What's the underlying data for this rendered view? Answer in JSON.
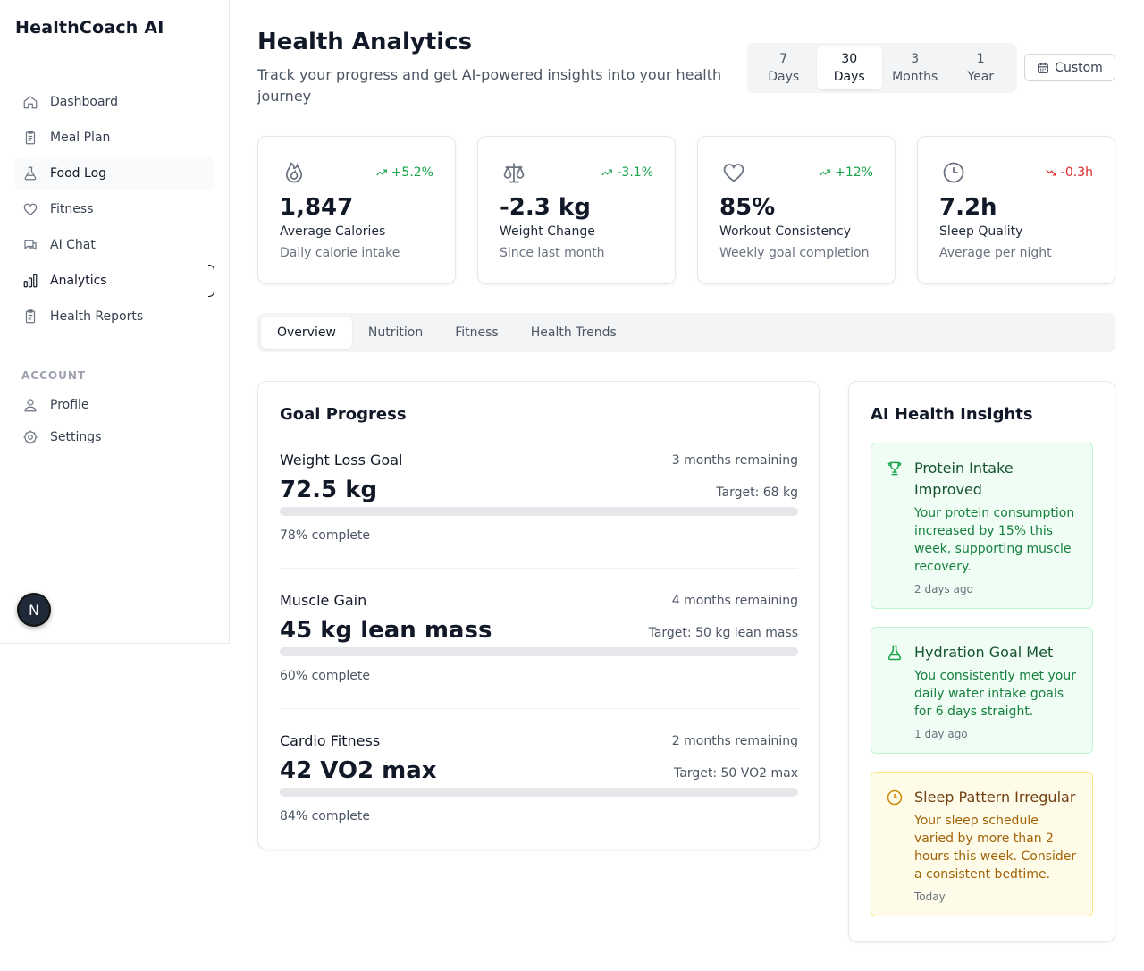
{
  "app": {
    "name": "HealthCoach AI"
  },
  "sidebar": {
    "items": [
      {
        "label": "Dashboard",
        "icon": "home-icon"
      },
      {
        "label": "Meal Plan",
        "icon": "clipboard-icon"
      },
      {
        "label": "Food Log",
        "icon": "flask-icon"
      },
      {
        "label": "Fitness",
        "icon": "heart-icon"
      },
      {
        "label": "AI Chat",
        "icon": "chat-icon"
      },
      {
        "label": "Analytics",
        "icon": "bar-chart-icon"
      },
      {
        "label": "Health Reports",
        "icon": "clipboard-icon"
      }
    ],
    "account_label": "ACCOUNT",
    "account_items": [
      {
        "label": "Profile",
        "icon": "user-icon"
      },
      {
        "label": "Settings",
        "icon": "gear-icon"
      }
    ],
    "badge": "N"
  },
  "header": {
    "title": "Health Analytics",
    "subtitle": "Track your progress and get AI-powered insights into your health journey",
    "ranges": [
      {
        "num": "7",
        "unit": "Days"
      },
      {
        "num": "30",
        "unit": "Days"
      },
      {
        "num": "3",
        "unit": "Months"
      },
      {
        "num": "1",
        "unit": "Year"
      }
    ],
    "selected_range": "30 Days",
    "custom_label": "Custom"
  },
  "stats": [
    {
      "value": "1,847",
      "label": "Average Calories",
      "sub": "Daily calorie intake",
      "trend": "+5.2%",
      "trend_dir": "up",
      "icon": "flame-icon"
    },
    {
      "value": "-2.3 kg",
      "label": "Weight Change",
      "sub": "Since last month",
      "trend": "-3.1%",
      "trend_dir": "up",
      "icon": "scale-icon"
    },
    {
      "value": "85%",
      "label": "Workout Consistency",
      "sub": "Weekly goal completion",
      "trend": "+12%",
      "trend_dir": "up",
      "icon": "heart-icon"
    },
    {
      "value": "7.2h",
      "label": "Sleep Quality",
      "sub": "Average per night",
      "trend": "-0.3h",
      "trend_dir": "down",
      "icon": "clock-icon"
    }
  ],
  "tabs": [
    "Overview",
    "Nutrition",
    "Fitness",
    "Health Trends"
  ],
  "goals": {
    "title": "Goal Progress",
    "items": [
      {
        "name": "Weight Loss Goal",
        "remaining": "3 months remaining",
        "value": "72.5 kg",
        "target": "Target: 68 kg",
        "percent": 78,
        "percent_label": "78% complete"
      },
      {
        "name": "Muscle Gain",
        "remaining": "4 months remaining",
        "value": "45 kg lean mass",
        "target": "Target: 50 kg lean mass",
        "percent": 60,
        "percent_label": "60% complete"
      },
      {
        "name": "Cardio Fitness",
        "remaining": "2 months remaining",
        "value": "42 VO2 max",
        "target": "Target: 50 VO2 max",
        "percent": 84,
        "percent_label": "84% complete"
      }
    ]
  },
  "insights": {
    "title": "AI Health Insights",
    "items": [
      {
        "title": "Protein Intake Improved",
        "text": "Your protein consumption increased by 15% this week, supporting muscle recovery.",
        "time": "2 days ago",
        "tone": "green",
        "icon": "trophy-icon"
      },
      {
        "title": "Hydration Goal Met",
        "text": "You consistently met your daily water intake goals for 6 days straight.",
        "time": "1 day ago",
        "tone": "green",
        "icon": "flask-icon"
      },
      {
        "title": "Sleep Pattern Irregular",
        "text": "Your sleep schedule varied by more than 2 hours this week. Consider a consistent bedtime.",
        "time": "Today",
        "tone": "yellow",
        "icon": "clock-icon"
      }
    ]
  }
}
